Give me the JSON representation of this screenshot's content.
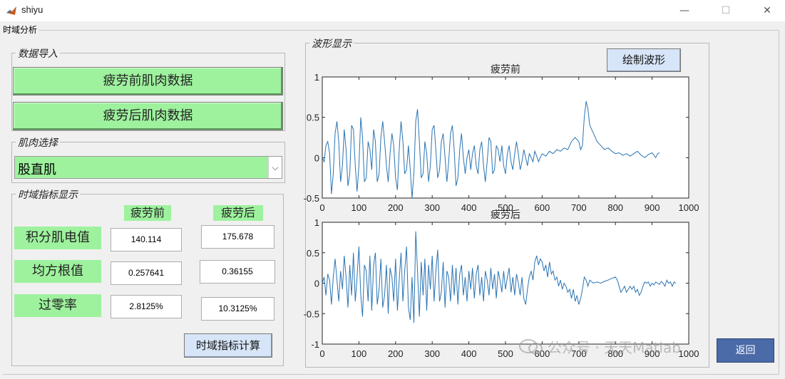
{
  "window": {
    "title": "shiyu",
    "minimize": "—",
    "maximize": "☐",
    "close": "✕"
  },
  "tab": {
    "label": "时域分析"
  },
  "data_import": {
    "title": "数据导入",
    "before_button": "疲劳前肌肉数据",
    "after_button": "疲劳后肌肉数据"
  },
  "muscle_select": {
    "title": "肌肉选择",
    "selected": "股直肌"
  },
  "indicators": {
    "title": "时域指标显示",
    "col_before": "疲劳前",
    "col_after": "疲劳后",
    "rows": [
      {
        "label": "积分肌电值",
        "before": "140.114",
        "after": "175.678"
      },
      {
        "label": "均方根值",
        "before": "0.257641",
        "after": "0.36155"
      },
      {
        "label": "过零率",
        "before": "2.8125%",
        "after": "10.3125%"
      }
    ],
    "calc_button": "时域指标计算"
  },
  "waveform": {
    "title": "波形显示",
    "draw_button": "绘制波形"
  },
  "return_button": "返回",
  "watermark": "公众号 · 天天Matlab",
  "chart_data": [
    {
      "type": "line",
      "title": "疲劳前",
      "xlim": [
        0,
        1000
      ],
      "ylim": [
        -0.5,
        1
      ],
      "xticks": [
        0,
        100,
        200,
        300,
        400,
        500,
        600,
        700,
        800,
        900,
        1000
      ],
      "yticks": [
        -0.5,
        0,
        0.5,
        1
      ],
      "ytick_labels": [
        "-0.5",
        "0",
        "0.5",
        "1"
      ],
      "color": "#2b74b3",
      "points": [
        [
          0,
          0.0
        ],
        [
          5,
          -0.05
        ],
        [
          10,
          0.15
        ],
        [
          15,
          0.2
        ],
        [
          20,
          0.05
        ],
        [
          25,
          -0.45
        ],
        [
          30,
          -0.2
        ],
        [
          35,
          0.3
        ],
        [
          40,
          0.45
        ],
        [
          45,
          0.2
        ],
        [
          50,
          -0.3
        ],
        [
          55,
          -0.1
        ],
        [
          60,
          0.35
        ],
        [
          65,
          0.1
        ],
        [
          70,
          -0.35
        ],
        [
          75,
          -0.2
        ],
        [
          80,
          0.4
        ],
        [
          85,
          0.35
        ],
        [
          90,
          -0.1
        ],
        [
          95,
          -0.42
        ],
        [
          100,
          -0.1
        ],
        [
          105,
          0.5
        ],
        [
          110,
          0.25
        ],
        [
          115,
          -0.3
        ],
        [
          120,
          -0.25
        ],
        [
          125,
          0.2
        ],
        [
          130,
          0.1
        ],
        [
          135,
          -0.15
        ],
        [
          140,
          0.35
        ],
        [
          145,
          0.2
        ],
        [
          150,
          -0.3
        ],
        [
          155,
          -0.2
        ],
        [
          160,
          0.25
        ],
        [
          165,
          0.45
        ],
        [
          170,
          0.2
        ],
        [
          175,
          -0.1
        ],
        [
          180,
          -0.3
        ],
        [
          185,
          0.05
        ],
        [
          190,
          0.3
        ],
        [
          195,
          0.15
        ],
        [
          200,
          -0.25
        ],
        [
          205,
          -0.4
        ],
        [
          210,
          0.1
        ],
        [
          215,
          0.45
        ],
        [
          220,
          0.2
        ],
        [
          225,
          -0.2
        ],
        [
          230,
          -0.15
        ],
        [
          235,
          0.15
        ],
        [
          240,
          -0.15
        ],
        [
          245,
          -0.52
        ],
        [
          250,
          -0.2
        ],
        [
          255,
          0.45
        ],
        [
          260,
          0.6
        ],
        [
          265,
          0.2
        ],
        [
          270,
          -0.25
        ],
        [
          275,
          -0.2
        ],
        [
          280,
          0.2
        ],
        [
          285,
          0.05
        ],
        [
          290,
          -0.3
        ],
        [
          295,
          -0.1
        ],
        [
          300,
          0.35
        ],
        [
          305,
          0.4
        ],
        [
          310,
          0.1
        ],
        [
          315,
          -0.25
        ],
        [
          320,
          -0.15
        ],
        [
          325,
          0.2
        ],
        [
          330,
          0.3
        ],
        [
          335,
          0.0
        ],
        [
          340,
          -0.3
        ],
        [
          345,
          -0.05
        ],
        [
          350,
          0.3
        ],
        [
          355,
          0.4
        ],
        [
          360,
          0.1
        ],
        [
          365,
          -0.35
        ],
        [
          370,
          -0.25
        ],
        [
          375,
          0.1
        ],
        [
          380,
          0.3
        ],
        [
          385,
          0.0
        ],
        [
          390,
          -0.2
        ],
        [
          395,
          0.0
        ],
        [
          400,
          0.1
        ],
        [
          405,
          -0.15
        ],
        [
          410,
          0.05
        ],
        [
          415,
          0.15
        ],
        [
          420,
          -0.1
        ],
        [
          425,
          -0.2
        ],
        [
          430,
          0.1
        ],
        [
          435,
          0.2
        ],
        [
          440,
          -0.1
        ],
        [
          445,
          -0.3
        ],
        [
          450,
          -0.05
        ],
        [
          455,
          0.25
        ],
        [
          460,
          0.2
        ],
        [
          465,
          -0.2
        ],
        [
          470,
          -0.15
        ],
        [
          475,
          0.15
        ],
        [
          480,
          0.1
        ],
        [
          485,
          -0.05
        ],
        [
          490,
          0.15
        ],
        [
          495,
          -0.1
        ],
        [
          500,
          -0.2
        ],
        [
          505,
          0.05
        ],
        [
          510,
          0.15
        ],
        [
          515,
          -0.05
        ],
        [
          520,
          -0.15
        ],
        [
          525,
          0.05
        ],
        [
          530,
          0.2
        ],
        [
          535,
          0.05
        ],
        [
          540,
          -0.15
        ],
        [
          545,
          -0.05
        ],
        [
          550,
          0.1
        ],
        [
          555,
          0.0
        ],
        [
          560,
          -0.1
        ],
        [
          565,
          0.05
        ],
        [
          570,
          0.0
        ],
        [
          575,
          -0.05
        ],
        [
          580,
          0.08
        ],
        [
          585,
          0.02
        ],
        [
          590,
          -0.05
        ],
        [
          595,
          0.0
        ],
        [
          600,
          0.05
        ],
        [
          610,
          0.02
        ],
        [
          620,
          0.08
        ],
        [
          630,
          0.05
        ],
        [
          640,
          0.1
        ],
        [
          650,
          0.08
        ],
        [
          660,
          0.12
        ],
        [
          670,
          0.1
        ],
        [
          680,
          0.2
        ],
        [
          690,
          0.25
        ],
        [
          700,
          0.2
        ],
        [
          705,
          0.1
        ],
        [
          710,
          0.15
        ],
        [
          715,
          0.5
        ],
        [
          720,
          0.7
        ],
        [
          725,
          0.6
        ],
        [
          730,
          0.4
        ],
        [
          740,
          0.3
        ],
        [
          750,
          0.2
        ],
        [
          760,
          0.15
        ],
        [
          770,
          0.1
        ],
        [
          780,
          0.12
        ],
        [
          790,
          0.08
        ],
        [
          800,
          0.05
        ],
        [
          810,
          0.06
        ],
        [
          820,
          0.03
        ],
        [
          830,
          0.05
        ],
        [
          840,
          0.02
        ],
        [
          850,
          0.05
        ],
        [
          860,
          0.08
        ],
        [
          870,
          0.03
        ],
        [
          880,
          0.0
        ],
        [
          890,
          0.04
        ],
        [
          900,
          0.06
        ],
        [
          905,
          0.03
        ],
        [
          910,
          0.0
        ],
        [
          915,
          0.05
        ],
        [
          920,
          0.06
        ]
      ]
    },
    {
      "type": "line",
      "title": "疲劳后",
      "xlim": [
        0,
        1000
      ],
      "ylim": [
        -1,
        1
      ],
      "xticks": [
        0,
        100,
        200,
        300,
        400,
        500,
        600,
        700,
        800,
        900,
        1000
      ],
      "yticks": [
        -1,
        -0.5,
        0,
        0.5,
        1
      ],
      "ytick_labels": [
        "-1",
        "-0.5",
        "0",
        "0.5",
        "1"
      ],
      "color": "#2b74b3",
      "points": [
        [
          0,
          0.0
        ],
        [
          5,
          0.1
        ],
        [
          10,
          -0.2
        ],
        [
          15,
          0.15
        ],
        [
          20,
          0.05
        ],
        [
          25,
          -0.35
        ],
        [
          30,
          0.1
        ],
        [
          35,
          0.4
        ],
        [
          40,
          0.05
        ],
        [
          45,
          -0.3
        ],
        [
          50,
          0.2
        ],
        [
          55,
          -0.1
        ],
        [
          60,
          0.45
        ],
        [
          65,
          0.1
        ],
        [
          70,
          -0.4
        ],
        [
          75,
          0.3
        ],
        [
          80,
          -0.2
        ],
        [
          85,
          0.5
        ],
        [
          90,
          -0.3
        ],
        [
          95,
          0.1
        ],
        [
          100,
          0.6
        ],
        [
          105,
          -0.2
        ],
        [
          110,
          -0.55
        ],
        [
          115,
          0.3
        ],
        [
          120,
          0.2
        ],
        [
          125,
          -0.3
        ],
        [
          130,
          0.45
        ],
        [
          135,
          -0.45
        ],
        [
          140,
          0.3
        ],
        [
          145,
          0.5
        ],
        [
          150,
          -0.35
        ],
        [
          155,
          -0.1
        ],
        [
          160,
          0.4
        ],
        [
          165,
          -0.4
        ],
        [
          170,
          -0.2
        ],
        [
          175,
          0.3
        ],
        [
          180,
          -0.5
        ],
        [
          185,
          0.25
        ],
        [
          190,
          0.1
        ],
        [
          195,
          -0.3
        ],
        [
          200,
          0.4
        ],
        [
          205,
          -0.45
        ],
        [
          210,
          0.05
        ],
        [
          215,
          0.5
        ],
        [
          220,
          -0.3
        ],
        [
          225,
          0.2
        ],
        [
          230,
          0.6
        ],
        [
          235,
          -0.4
        ],
        [
          240,
          -0.6
        ],
        [
          245,
          0.1
        ],
        [
          250,
          -0.65
        ],
        [
          255,
          0.85
        ],
        [
          260,
          0.2
        ],
        [
          265,
          -0.55
        ],
        [
          270,
          0.35
        ],
        [
          275,
          -0.2
        ],
        [
          280,
          0.4
        ],
        [
          285,
          -0.45
        ],
        [
          290,
          0.3
        ],
        [
          295,
          -0.1
        ],
        [
          300,
          0.45
        ],
        [
          305,
          -0.3
        ],
        [
          310,
          0.2
        ],
        [
          315,
          0.55
        ],
        [
          320,
          -0.3
        ],
        [
          325,
          -0.15
        ],
        [
          330,
          0.35
        ],
        [
          335,
          -0.4
        ],
        [
          340,
          0.2
        ],
        [
          345,
          0.1
        ],
        [
          350,
          -0.3
        ],
        [
          355,
          0.3
        ],
        [
          360,
          -0.2
        ],
        [
          365,
          0.25
        ],
        [
          370,
          -0.35
        ],
        [
          375,
          0.15
        ],
        [
          380,
          0.3
        ],
        [
          385,
          -0.2
        ],
        [
          390,
          0.1
        ],
        [
          395,
          -0.3
        ],
        [
          400,
          0.2
        ],
        [
          405,
          -0.1
        ],
        [
          410,
          0.25
        ],
        [
          415,
          -0.25
        ],
        [
          420,
          0.15
        ],
        [
          425,
          0.3
        ],
        [
          430,
          -0.2
        ],
        [
          435,
          0.1
        ],
        [
          440,
          -0.3
        ],
        [
          445,
          0.2
        ],
        [
          450,
          0.05
        ],
        [
          455,
          -0.2
        ],
        [
          460,
          0.25
        ],
        [
          465,
          -0.1
        ],
        [
          470,
          0.15
        ],
        [
          475,
          -0.25
        ],
        [
          480,
          0.2
        ],
        [
          485,
          0.05
        ],
        [
          490,
          -0.15
        ],
        [
          495,
          0.2
        ],
        [
          500,
          -0.1
        ],
        [
          505,
          0.1
        ],
        [
          510,
          0.25
        ],
        [
          515,
          -0.15
        ],
        [
          520,
          0.1
        ],
        [
          525,
          -0.2
        ],
        [
          530,
          0.15
        ],
        [
          535,
          0.0
        ],
        [
          540,
          -0.2
        ],
        [
          545,
          0.1
        ],
        [
          550,
          -0.25
        ],
        [
          555,
          -0.35
        ],
        [
          560,
          -0.1
        ],
        [
          565,
          0.1
        ],
        [
          570,
          0.2
        ],
        [
          575,
          0.05
        ],
        [
          580,
          0.35
        ],
        [
          585,
          0.45
        ],
        [
          590,
          0.3
        ],
        [
          595,
          0.4
        ],
        [
          600,
          0.35
        ],
        [
          605,
          0.2
        ],
        [
          610,
          0.3
        ],
        [
          615,
          0.1
        ],
        [
          620,
          0.35
        ],
        [
          625,
          0.15
        ],
        [
          630,
          0.2
        ],
        [
          635,
          0.05
        ],
        [
          640,
          0.1
        ],
        [
          645,
          -0.05
        ],
        [
          650,
          0.05
        ],
        [
          655,
          -0.1
        ],
        [
          660,
          0.0
        ],
        [
          665,
          -0.05
        ],
        [
          670,
          -0.15
        ],
        [
          675,
          -0.1
        ],
        [
          680,
          -0.25
        ],
        [
          685,
          -0.1
        ],
        [
          690,
          -0.3
        ],
        [
          695,
          -0.2
        ],
        [
          700,
          -0.35
        ],
        [
          705,
          -0.25
        ],
        [
          710,
          -0.1
        ],
        [
          715,
          0.1
        ],
        [
          720,
          0.05
        ],
        [
          725,
          -0.05
        ],
        [
          730,
          0.05
        ],
        [
          740,
          0.0
        ],
        [
          750,
          0.02
        ],
        [
          760,
          0.0
        ],
        [
          770,
          0.03
        ],
        [
          780,
          0.05
        ],
        [
          790,
          0.08
        ],
        [
          800,
          0.1
        ],
        [
          805,
          0.05
        ],
        [
          810,
          -0.05
        ],
        [
          815,
          -0.15
        ],
        [
          820,
          -0.1
        ],
        [
          825,
          -0.05
        ],
        [
          830,
          -0.15
        ],
        [
          835,
          -0.1
        ],
        [
          840,
          -0.05
        ],
        [
          845,
          -0.1
        ],
        [
          850,
          -0.05
        ],
        [
          855,
          -0.15
        ],
        [
          860,
          -0.1
        ],
        [
          865,
          -0.2
        ],
        [
          870,
          -0.15
        ],
        [
          875,
          -0.05
        ],
        [
          880,
          0.02
        ],
        [
          885,
          0.0
        ],
        [
          890,
          0.02
        ],
        [
          895,
          -0.05
        ],
        [
          900,
          0.0
        ],
        [
          905,
          -0.03
        ],
        [
          910,
          0.02
        ],
        [
          915,
          0.0
        ],
        [
          920,
          -0.02
        ],
        [
          925,
          0.03
        ],
        [
          930,
          0.0
        ],
        [
          935,
          -0.05
        ],
        [
          940,
          0.05
        ],
        [
          945,
          0.0
        ],
        [
          950,
          0.02
        ],
        [
          955,
          -0.05
        ],
        [
          960,
          0.02
        ],
        [
          965,
          0.0
        ]
      ]
    }
  ]
}
